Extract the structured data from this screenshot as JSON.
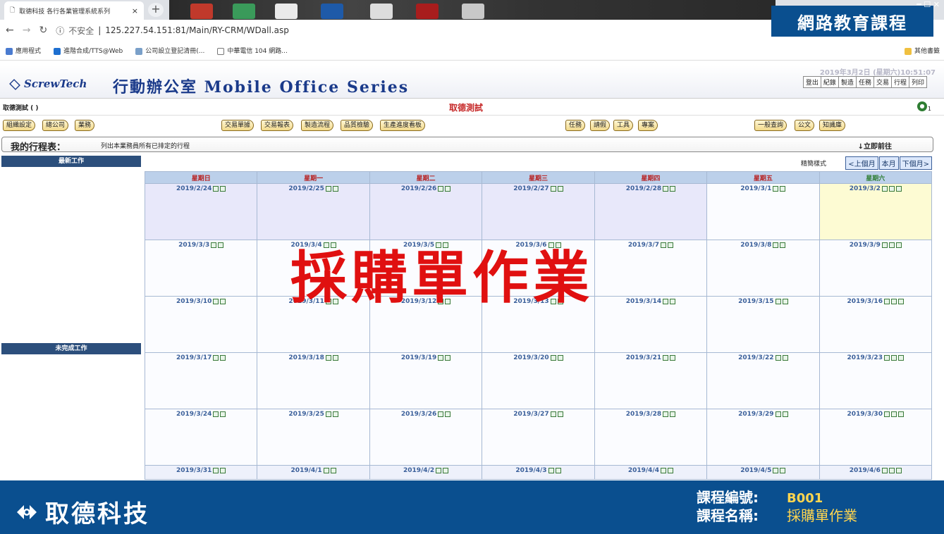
{
  "browser": {
    "tab_title": "取德科技 各行各業管理系統系列",
    "tab_close": "×",
    "new_tab": "+",
    "security": "不安全",
    "url": "125.227.54.151:81/Main/RY-CRM/WDall.asp",
    "bookmarks": [
      "應用程式",
      "進階合成/TTS@Web",
      "公司設立登記清冊(...",
      "中華電信 104 網路..."
    ],
    "other_bookmarks": "其他書籤"
  },
  "overlay": {
    "course_banner": "網路教育課程",
    "big_text": "採購單作業"
  },
  "app": {
    "logo": "ScrewTech",
    "series_title": "行動辦公室 Mobile Office Series",
    "datetime": "2019年3月2日 (星期六)10:51:07",
    "top_menu": [
      "登出",
      "紀錄",
      "製造",
      "任務",
      "交易",
      "行程",
      "列印"
    ],
    "user": "取德測試 ( )",
    "company": "取德測試",
    "online_count": "1",
    "menus": [
      "組織設定",
      "總公司",
      "業務",
      "交易單據",
      "交易報表",
      "製造流程",
      "品質檢驗",
      "生產進度看板",
      "任務",
      "請假",
      "工具",
      "專案",
      "一般查詢",
      "公文",
      "知識庫"
    ],
    "schedule_title": "我的行程表：",
    "schedule_desc": "列出本業務員所有已排定的行程",
    "go_now": "↓立即前往",
    "side_latest": "最新工作",
    "side_pending": "未完成工作",
    "calendar": {
      "style_label": "精簡樣式",
      "nav": [
        "<上個月",
        "本月",
        "下個月>"
      ],
      "weekdays": [
        "星期日",
        "星期一",
        "星期二",
        "星期三",
        "星期四",
        "星期五",
        "星期六"
      ],
      "weeks": [
        [
          "2019/2/24",
          "2019/2/25",
          "2019/2/26",
          "2019/2/27",
          "2019/2/28",
          "2019/3/1",
          "2019/3/2"
        ],
        [
          "2019/3/3",
          "2019/3/4",
          "2019/3/5",
          "2019/3/6",
          "2019/3/7",
          "2019/3/8",
          "2019/3/9"
        ],
        [
          "2019/3/10",
          "2019/3/11",
          "2019/3/12",
          "2019/3/13",
          "2019/3/14",
          "2019/3/15",
          "2019/3/16"
        ],
        [
          "2019/3/17",
          "2019/3/18",
          "2019/3/19",
          "2019/3/20",
          "2019/3/21",
          "2019/3/22",
          "2019/3/23"
        ],
        [
          "2019/3/24",
          "2019/3/25",
          "2019/3/26",
          "2019/3/27",
          "2019/3/28",
          "2019/3/29",
          "2019/3/30"
        ],
        [
          "2019/3/31",
          "2019/4/1",
          "2019/4/2",
          "2019/4/3",
          "2019/4/4",
          "2019/4/5",
          "2019/4/6"
        ]
      ]
    }
  },
  "footer": {
    "company": "取德科技",
    "code_label": "課程編號:",
    "code": "B001",
    "name_label": "課程名稱:",
    "name": "採購單作業"
  },
  "colors": {
    "banner_blue": "#0a4f8f",
    "accent_red": "#e01010",
    "highlight_yellow": "#ffd54f"
  }
}
